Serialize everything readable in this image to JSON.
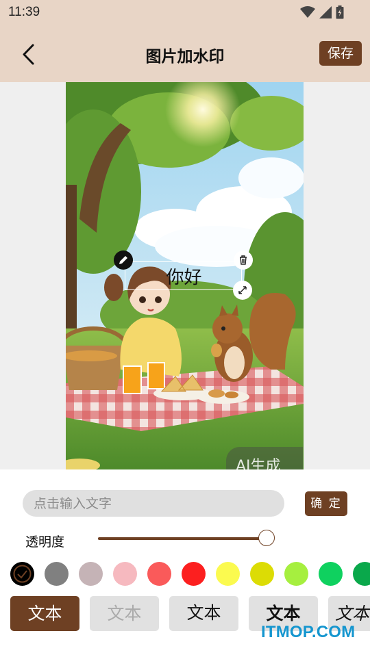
{
  "status_bar": {
    "time": "11:39"
  },
  "header": {
    "title": "图片加水印",
    "save_label": "保存"
  },
  "canvas": {
    "watermark_text": "你好",
    "ai_badge": "AI生成"
  },
  "controls": {
    "input_placeholder": "点击输入文字",
    "input_value": "",
    "confirm_label": "确 定",
    "opacity_label": "透明度",
    "opacity_value": 0.97,
    "accent_color": "#6e4023"
  },
  "colors": [
    {
      "hex": "#000000",
      "selected": true
    },
    {
      "hex": "#808080",
      "selected": false
    },
    {
      "hex": "#c5b3b6",
      "selected": false
    },
    {
      "hex": "#f6b9bf",
      "selected": false
    },
    {
      "hex": "#fa5a5a",
      "selected": false
    },
    {
      "hex": "#fc1f1f",
      "selected": false
    },
    {
      "hex": "#fbfa4f",
      "selected": false
    },
    {
      "hex": "#dcdc05",
      "selected": false
    },
    {
      "hex": "#a6ef3f",
      "selected": false
    },
    {
      "hex": "#0fd15f",
      "selected": false
    },
    {
      "hex": "#0aa84b",
      "selected": false
    }
  ],
  "fonts": [
    {
      "label": "文本",
      "selected": true
    },
    {
      "label": "文本",
      "selected": false
    },
    {
      "label": "文本",
      "selected": false
    },
    {
      "label": "文本",
      "selected": false
    },
    {
      "label": "文本",
      "selected": false
    }
  ],
  "site_watermark": "ITMOP.COM"
}
